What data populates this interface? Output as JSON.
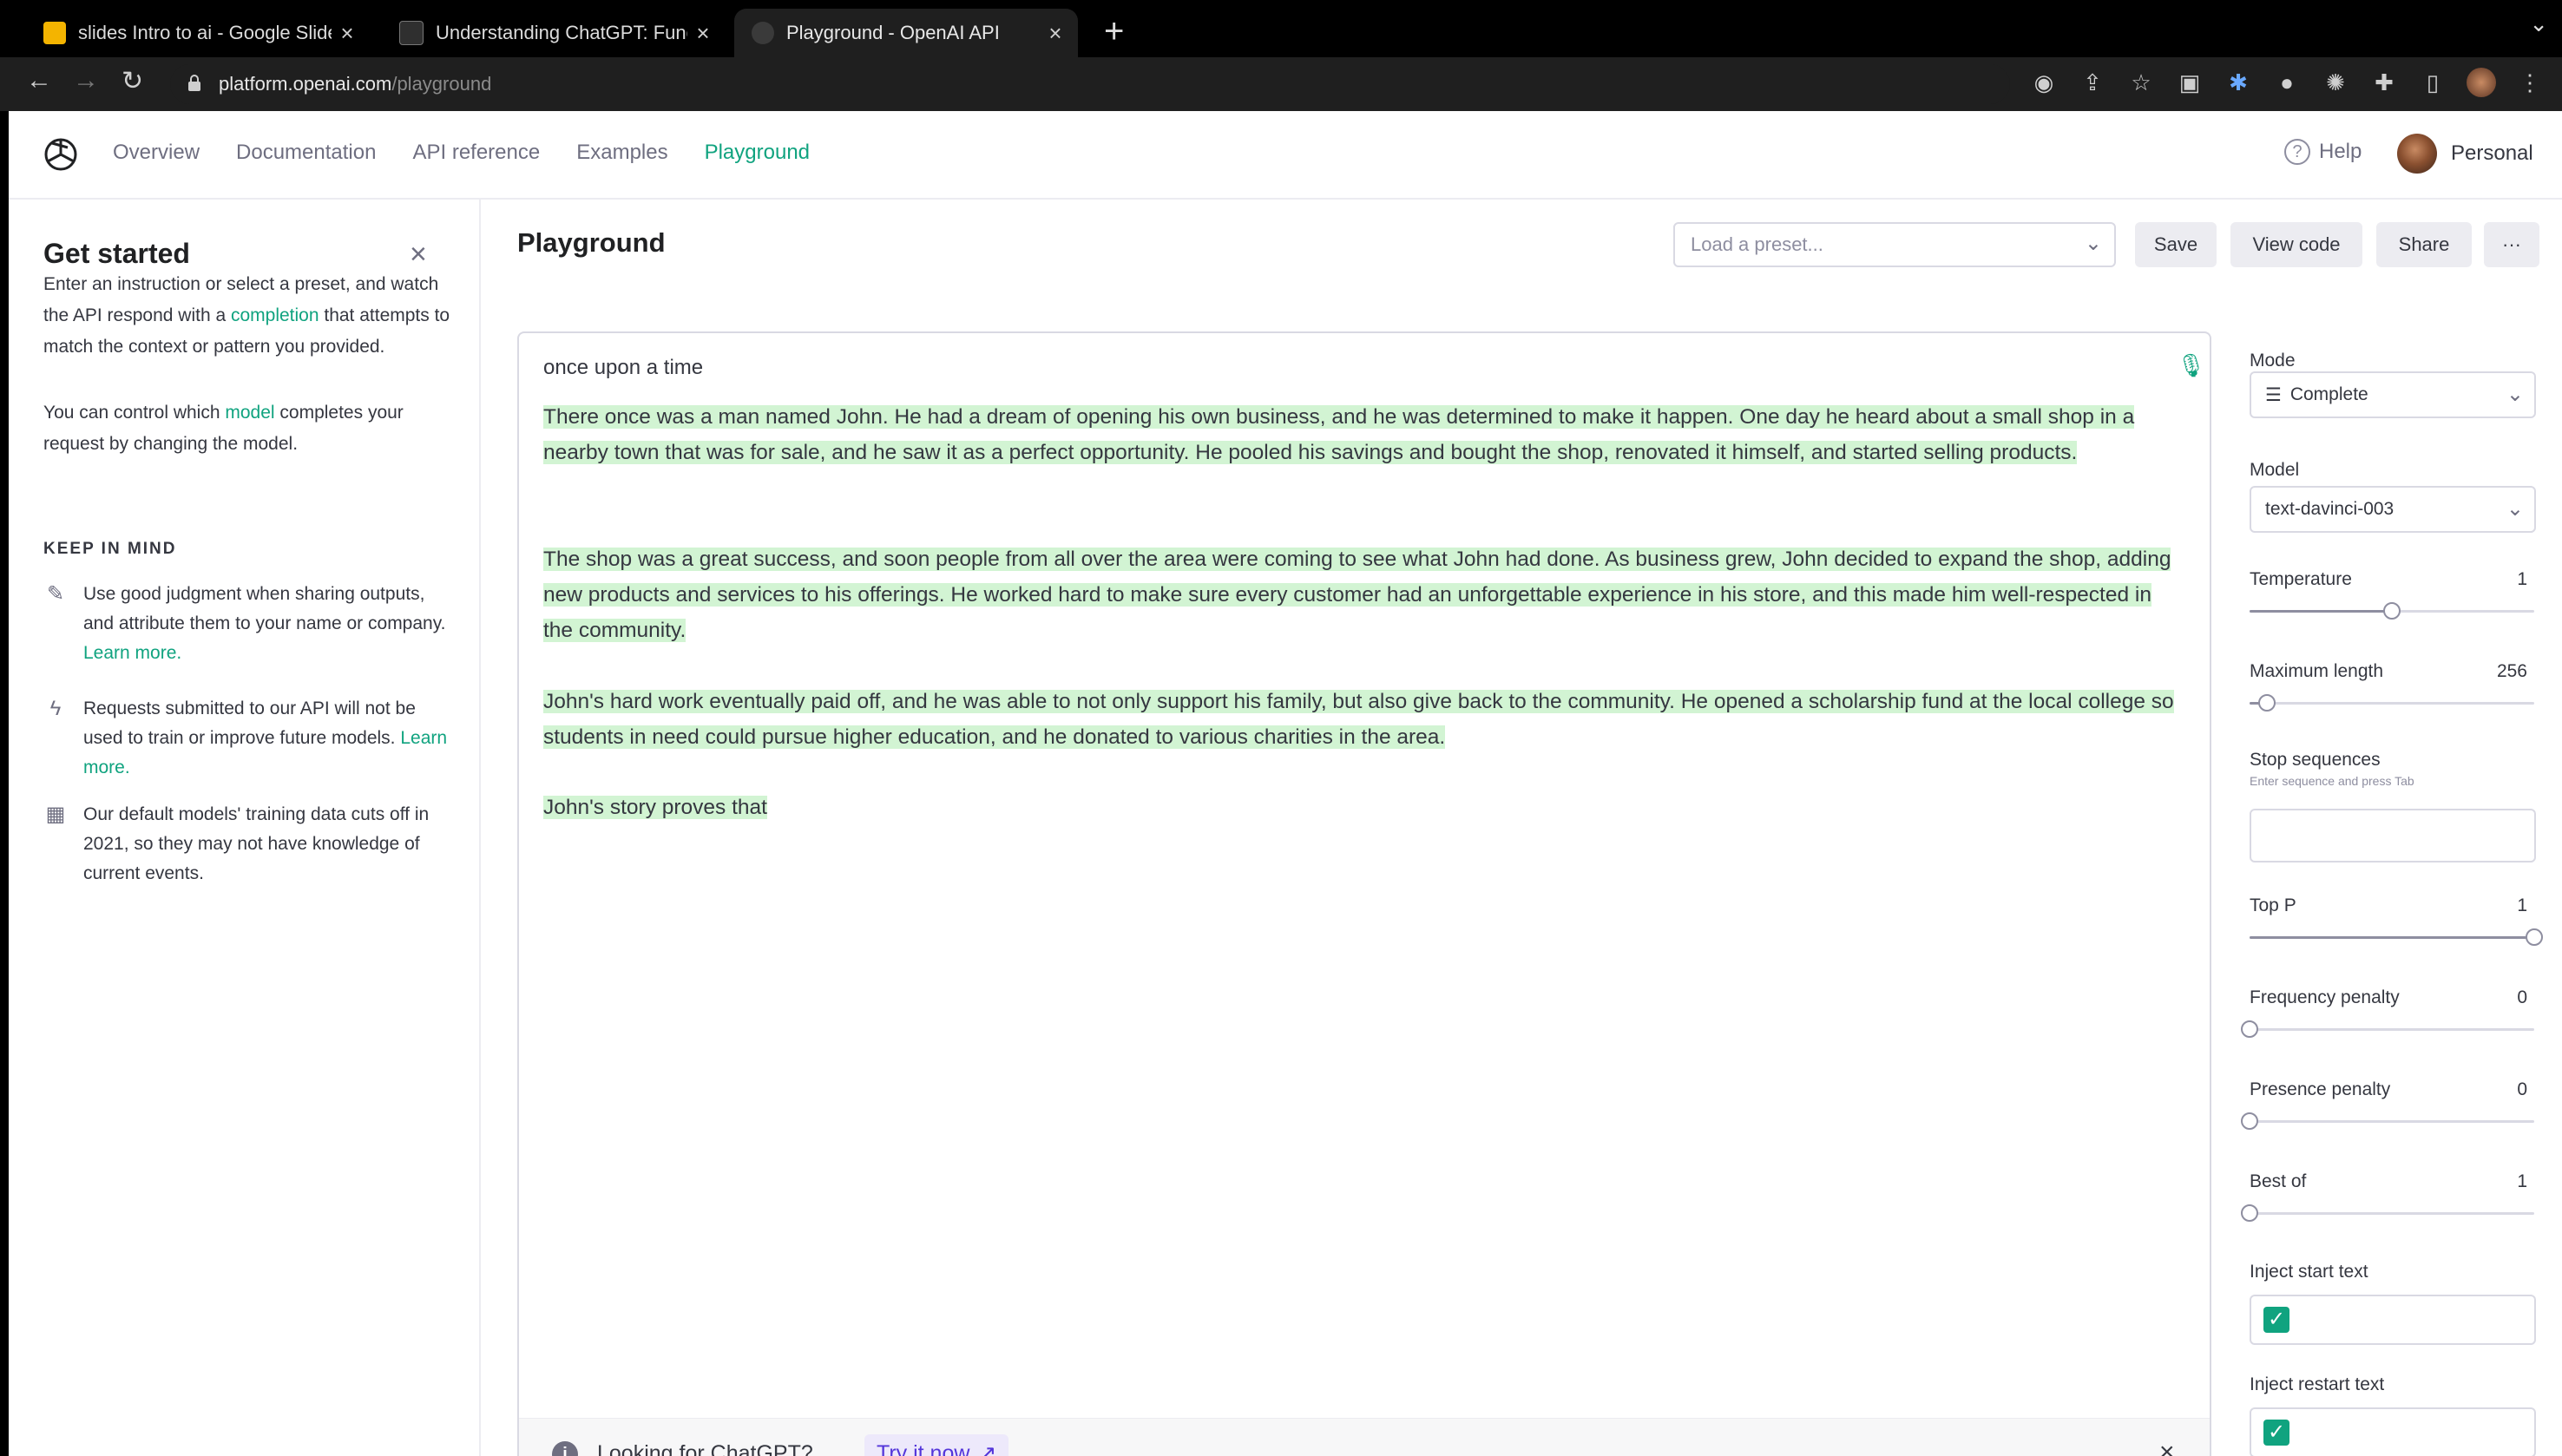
{
  "browser": {
    "tabs": [
      {
        "title": "slides Intro to ai - Google Slides",
        "favicon_color": "#f4b400",
        "active": false
      },
      {
        "title": "Understanding ChatGPT: Fund",
        "favicon_color": "#2f2f2f",
        "active": false
      },
      {
        "title": "Playground - OpenAI API",
        "favicon_color": "#3a3a3a",
        "active": true
      }
    ],
    "url_host": "platform.openai.com",
    "url_path": "/playground",
    "new_tab_label": "+",
    "close_label": "×"
  },
  "nav": {
    "links": [
      "Overview",
      "Documentation",
      "API reference",
      "Examples",
      "Playground"
    ],
    "active_index": 4,
    "help_label": "Help",
    "account_label": "Personal"
  },
  "sidebar": {
    "title": "Get started",
    "close_label": "×",
    "intro_before": "Enter an instruction or select a preset, and watch the API respond with a ",
    "intro_link": "completion",
    "intro_after": " that attempts to match the context or pattern you provided.",
    "model_before": "You can control which ",
    "model_link": "model",
    "model_after": " completes your request by changing the model.",
    "keep_in_mind": "KEEP IN MIND",
    "tips": [
      {
        "icon": "pin-icon",
        "glyph": "✎",
        "text": "Use good judgment when sharing outputs, and attribute them to your name or company. ",
        "link": "Learn more."
      },
      {
        "icon": "bolt-icon",
        "glyph": "ϟ",
        "text": "Requests submitted to our API will not be used to train or improve future models. ",
        "link": "Learn more."
      },
      {
        "icon": "calendar-icon",
        "glyph": "▦",
        "text": "Our default models' training data cuts off in 2021, so they may not have knowledge of current events.",
        "link": ""
      }
    ]
  },
  "header": {
    "title": "Playground",
    "preset_placeholder": "Load a preset...",
    "buttons": [
      "Save",
      "View code",
      "Share",
      "···"
    ]
  },
  "editor": {
    "prompt": "once upon a time",
    "paragraphs": [
      "There once was a man named John. He had a dream of opening his own business, and he was determined to make it happen. One day he heard about a small shop in a nearby town that was for sale, and he saw it as a perfect opportunity. He pooled his savings and bought the shop, renovated it himself, and started selling products.",
      "The shop was a great success, and soon people from all over the area were coming to see what John had done. As business grew, John decided to expand the shop, adding new products and services to his offerings. He worked hard to make sure every customer had an unforgettable experience in his store, and this made him well-respected in the community.",
      "John's hard work eventually paid off, and he was able to not only support his family, but also give back to the community. He opened a scholarship fund at the local college so students in need could pursue higher education, and he donated to various charities in the area.",
      "John's story proves that"
    ],
    "highlight_color": "#d2f4d3",
    "banner_text": "Looking for ChatGPT?",
    "banner_link": "Try it now",
    "banner_close": "×"
  },
  "settings": {
    "mode_label": "Mode",
    "mode_value": "Complete",
    "model_label": "Model",
    "model_value": "text-davinci-003",
    "temperature": {
      "label": "Temperature",
      "value": "1",
      "fraction": 0.5
    },
    "max_length": {
      "label": "Maximum length",
      "value": "256",
      "fraction": 0.06
    },
    "stop_label": "Stop sequences",
    "stop_hint": "Enter sequence and press Tab",
    "top_p": {
      "label": "Top P",
      "value": "1",
      "fraction": 1.0
    },
    "frequency_penalty": {
      "label": "Frequency penalty",
      "value": "0",
      "fraction": 0.0
    },
    "presence_penalty": {
      "label": "Presence penalty",
      "value": "0",
      "fraction": 0.0
    },
    "best_of": {
      "label": "Best of",
      "value": "1",
      "fraction": 0.0
    },
    "inject_start_label": "Inject start text",
    "inject_restart_label": "Inject restart text",
    "accent_color": "#10a37f"
  }
}
